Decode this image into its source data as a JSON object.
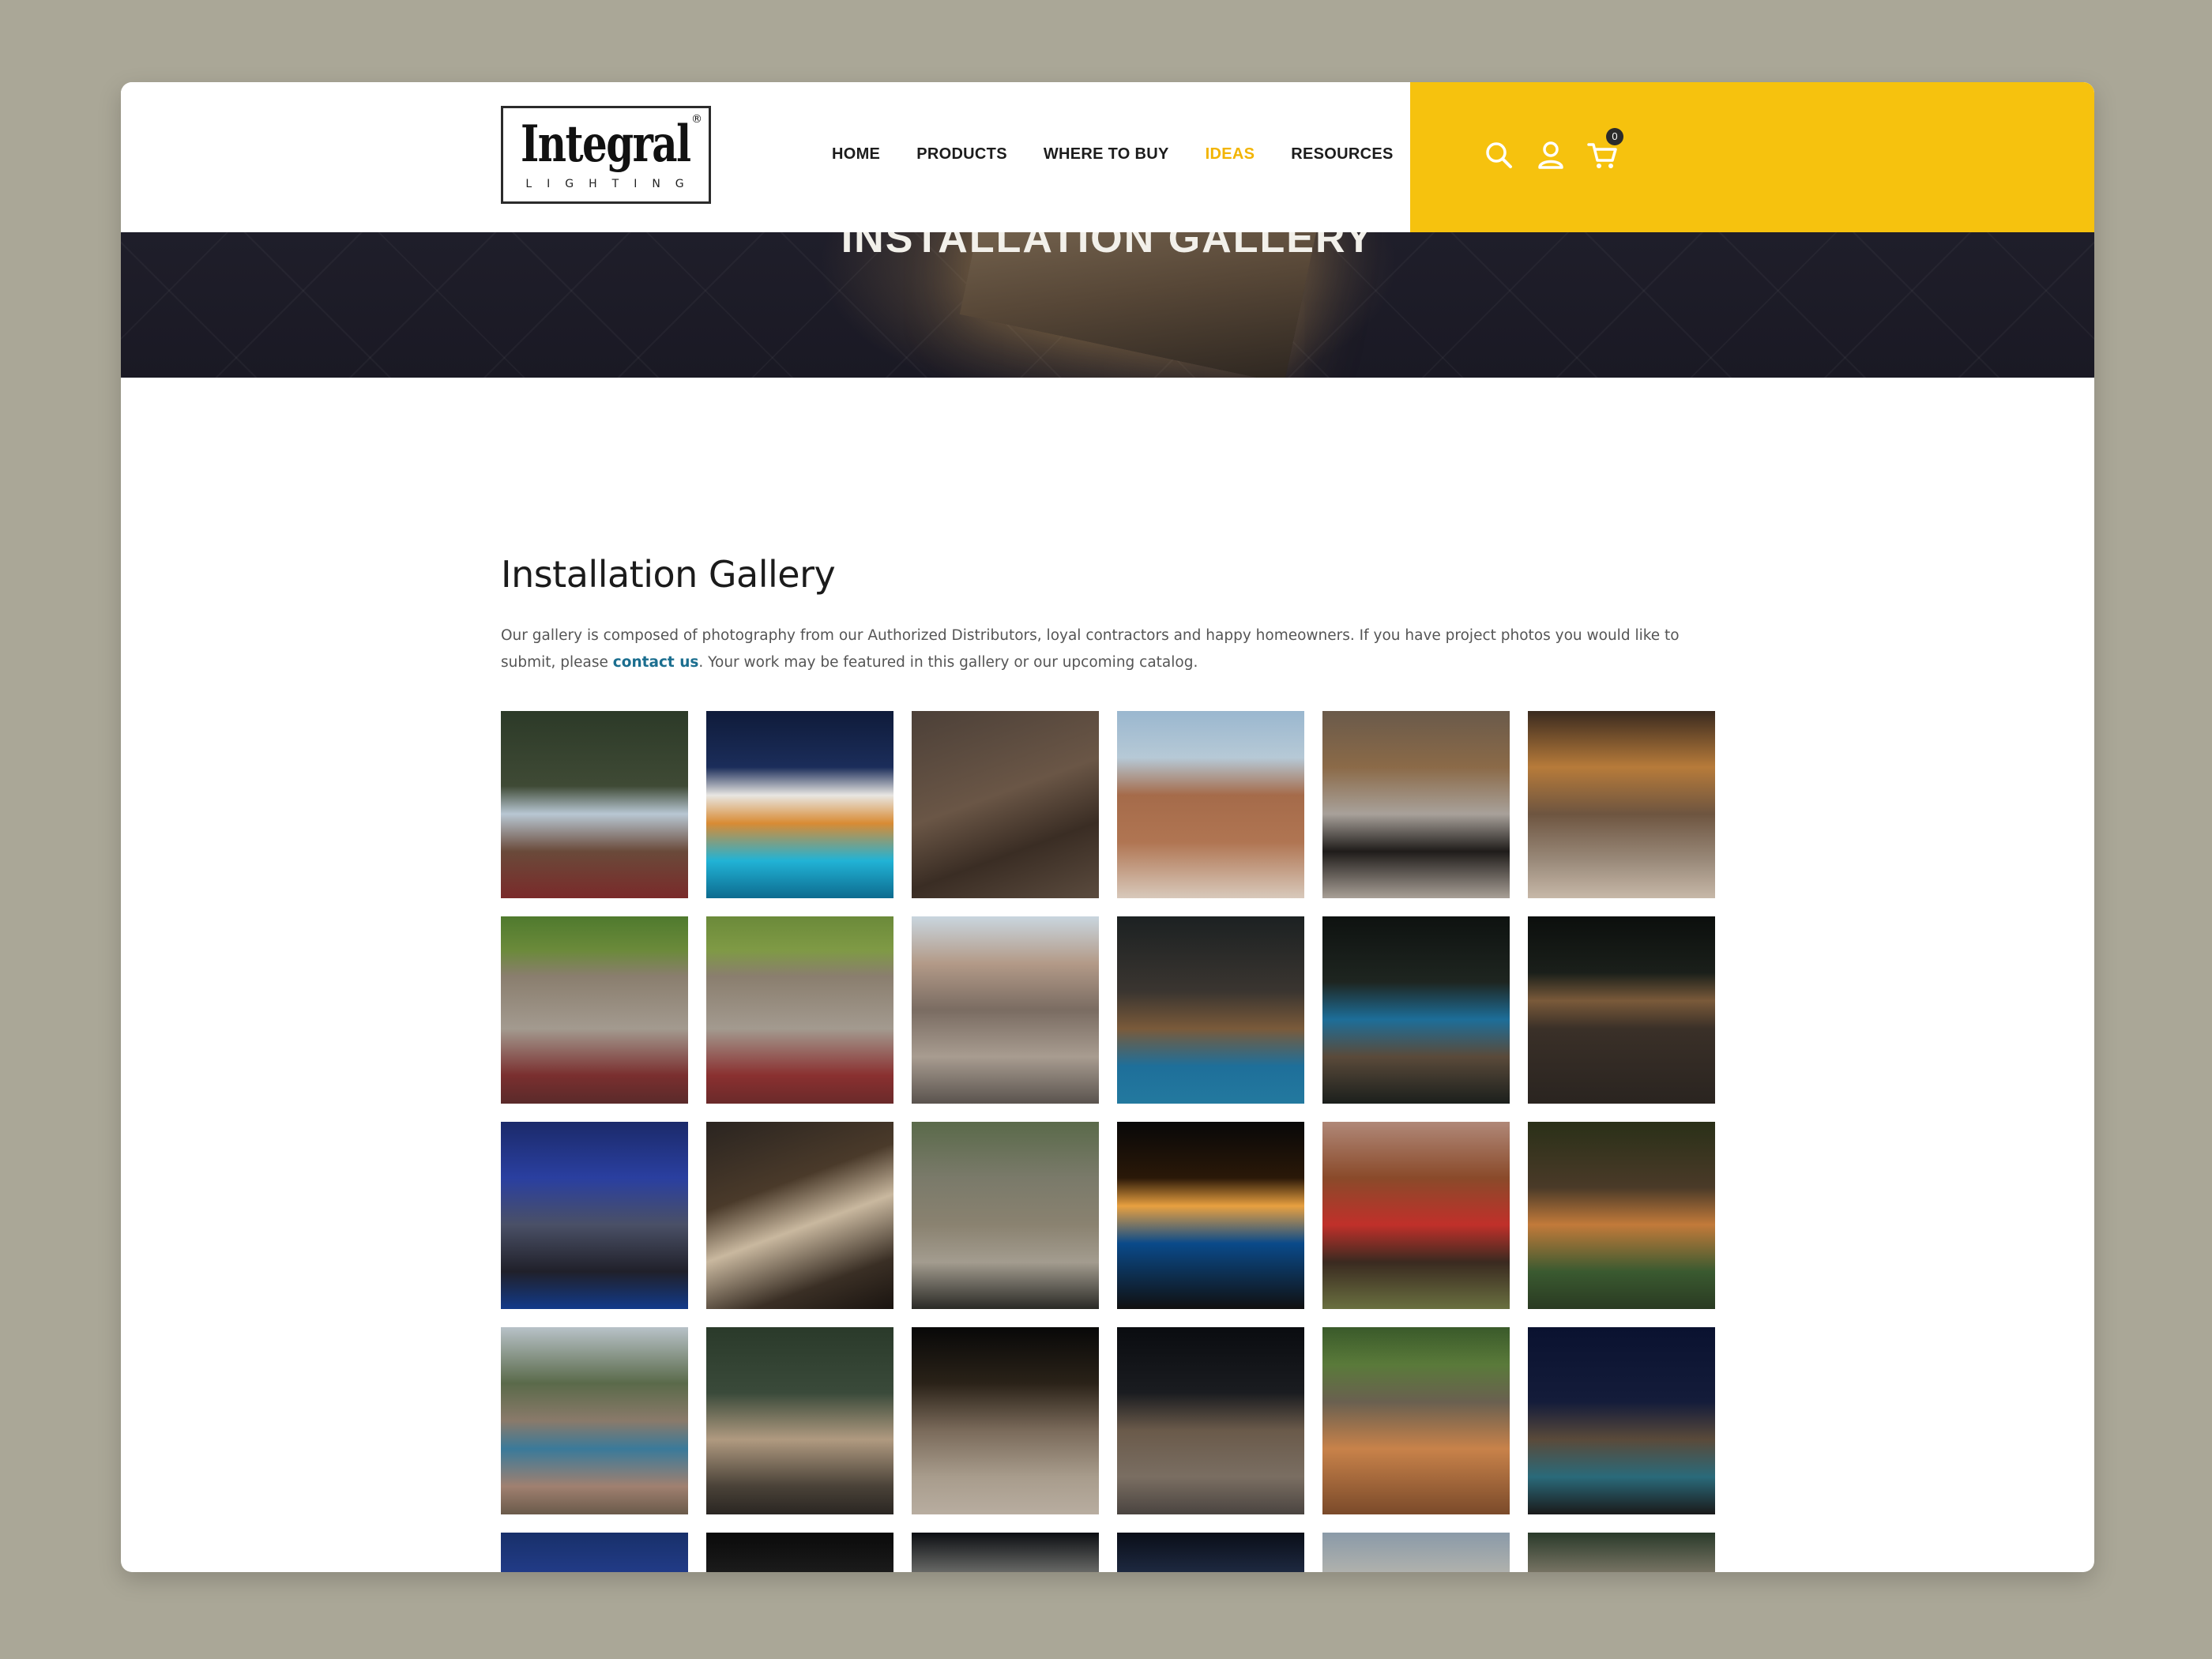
{
  "brand": {
    "logo_word": "Integral",
    "logo_sub": "LIGHTING",
    "logo_reg": "®",
    "accent_yellow": "#f6c20e"
  },
  "nav": {
    "items": [
      {
        "label": "HOME",
        "active": false
      },
      {
        "label": "PRODUCTS",
        "active": false
      },
      {
        "label": "WHERE TO BUY",
        "active": false
      },
      {
        "label": "IDEAS",
        "active": true
      },
      {
        "label": "RESOURCES",
        "active": false
      }
    ],
    "active_color": "#f2b400"
  },
  "header_icons": {
    "search": "search-icon",
    "account": "user-icon",
    "cart": "cart-icon",
    "cart_count": "0"
  },
  "hero": {
    "title": "INSTALLATION GALLERY"
  },
  "main": {
    "title": "Installation Gallery",
    "intro_before": "Our gallery is composed of photography from our Authorized Distributors, loyal contractors and happy homeowners. If you have project photos you would like to submit, please ",
    "intro_link": "contact us",
    "intro_after": ". Your work may be featured in this gallery or our upcoming catalog."
  },
  "gallery": {
    "tiles": [
      {
        "bg": "linear-gradient(180deg,#2c3a28 0%,#3f4a35 40%,#b8c7d3 55%,#6a4a3a 75%,#7a2a2a 100%)"
      },
      {
        "bg": "linear-gradient(180deg,#0f1b3a 0%,#1b2d5a 30%,#e8e6e2 45%,#d98b34 60%,#21b3d6 80%,#0d6b8f 100%)"
      },
      {
        "bg": "linear-gradient(160deg,#4c4038 0%,#6a5646 45%,#3a2d24 70%,#5b4b3e 100%)"
      },
      {
        "bg": "linear-gradient(180deg,#9ab7cf 0%,#b6c9d6 25%,#a56b4a 45%,#b07552 70%,#d8c9bb 100%)"
      },
      {
        "bg": "linear-gradient(180deg,#6a5a4a 0%,#8b6a48 30%,#a8a19a 55%,#1f1c1a 75%,#a89f96 100%)"
      },
      {
        "bg": "linear-gradient(180deg,#3a2a1f 0%,#b77b3a 30%,#6e5540 55%,#9a8a7a 80%,#c7b8a8 100%)"
      },
      {
        "bg": "linear-gradient(180deg,#4f7a2e 0%,#6b8a3a 18%,#8a7e6e 32%,#a39a8f 60%,#7a2f2f 85%,#5a2a2a 100%)"
      },
      {
        "bg": "linear-gradient(180deg,#6b8a3a 0%,#7f9a45 18%,#8a7e6e 32%,#a39a8f 60%,#8a3030 85%,#6a2a2a 100%)"
      },
      {
        "bg": "linear-gradient(180deg,#c9d6df 0%,#b39a88 25%,#7a6c62 50%,#a89c90 75%,#5a534e 100%)"
      },
      {
        "bg": "linear-gradient(180deg,#1c2122 0%,#3a3530 40%,#7a5a3a 60%,#1e6f9a 80%,#23799f 100%)"
      },
      {
        "bg": "linear-gradient(180deg,#0e1210 0%,#1e2520 35%,#1d6e99 55%,#5a4a3a 75%,#1b1f1c 100%)"
      },
      {
        "bg": "linear-gradient(180deg,#0c0f0d 0%,#1a1f1a 30%,#7a5a3a 45%,#3a3028 60%,#2a2420 100%)"
      },
      {
        "bg": "linear-gradient(180deg,#1b2a6a 0%,#2a3fa0 30%,#4a5066 55%,#20202a 80%,#123a8a 100%)"
      },
      {
        "bg": "linear-gradient(160deg,#2a2420 0%,#4a3a2a 35%,#c9b89f 55%,#3a2f25 80%,#1a1410 100%)"
      },
      {
        "bg": "linear-gradient(180deg,#5a6a4a 0%,#7a7a6a 30%,#8a8270 55%,#a39c8f 75%,#2a2a26 100%)"
      },
      {
        "bg": "linear-gradient(180deg,#080808 0%,#2a1808 30%,#e8a040 45%,#0a4a8a 65%,#101010 100%)"
      },
      {
        "bg": "linear-gradient(180deg,#b08878 0%,#8a4a2a 30%,#c0302a 55%,#3a2a20 75%,#6a7040 100%)"
      },
      {
        "bg": "linear-gradient(180deg,#2a3018 0%,#4a3a28 35%,#c27a3a 55%,#3a5a30 80%,#2a3a22 100%)"
      },
      {
        "bg": "linear-gradient(180deg,#b8c2c8 0%,#5a6a4a 30%,#8a7a6a 50%,#3a7a9a 65%,#a08070 85%,#6a5a4a 100%)"
      },
      {
        "bg": "linear-gradient(180deg,#2a3a2a 0%,#3a4a3a 35%,#b09a80 60%,#4a4238 85%,#2a2622 100%)"
      },
      {
        "bg": "linear-gradient(180deg,#080808 0%,#2a2218 30%,#7a6a5a 55%,#a89c8c 80%,#b8ada0 100%)"
      },
      {
        "bg": "linear-gradient(180deg,#0a0c10 0%,#1a1c20 35%,#6a5a4a 55%,#7a6e62 80%,#4a4440 100%)"
      },
      {
        "bg": "linear-gradient(180deg,#3a5a2a 0%,#5a7a3a 20%,#6a6050 40%,#c8824a 65%,#7a4a2a 100%)"
      },
      {
        "bg": "linear-gradient(180deg,#0a1230 0%,#141c3a 40%,#5a4a3a 60%,#2a6a7a 80%,#1a1a1a 100%)"
      },
      {
        "bg": "linear-gradient(180deg,#18306a 0%,#2a45a0 40%,#0c1220 70%,#1a1410 100%)"
      },
      {
        "bg": "linear-gradient(180deg,#0a0a0a 0%,#2a2a2a 40%,#9a8270 70%,#5a4e44 100%)"
      },
      {
        "bg": "linear-gradient(180deg,#0c0e12 0%,#b8b8b0 40%,#e0a050 60%,#6a5a4a 100%)"
      },
      {
        "bg": "linear-gradient(180deg,#0a0e18 0%,#2a3a5a 35%,#e09a50 60%,#2a2a2a 100%)"
      },
      {
        "bg": "linear-gradient(180deg,#8a9aa8 0%,#c8c0b0 35%,#9a8a7a 60%,#6a5a4a 100%)"
      },
      {
        "bg": "linear-gradient(180deg,#2a3a2a 0%,#a89888 35%,#d8d0c4 55%,#c0603a 80%,#6a4a3a 100%)"
      }
    ]
  }
}
